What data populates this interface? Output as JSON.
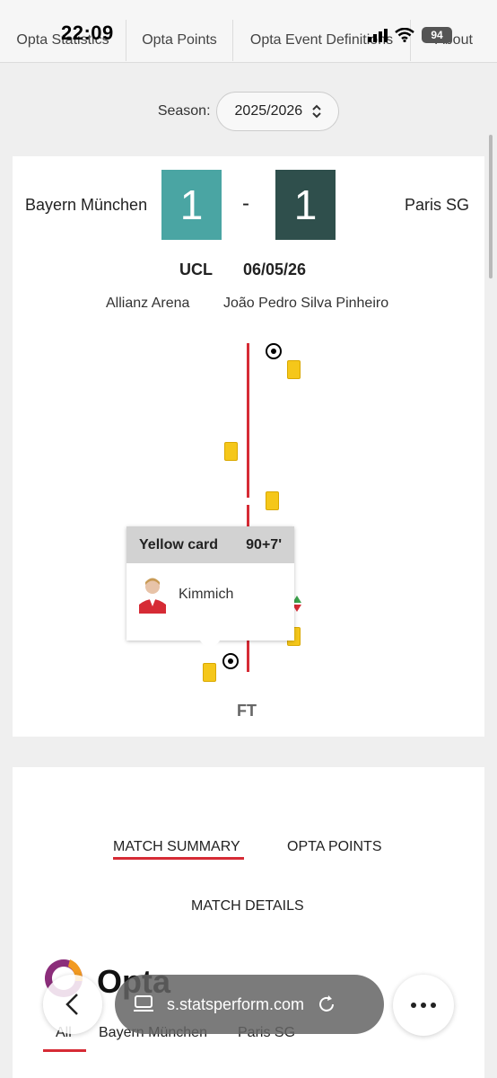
{
  "status_bar": {
    "time": "22:09",
    "battery": "94"
  },
  "nav": {
    "tabs": [
      "Opta Statistics",
      "Opta Points",
      "Opta Event Definitions",
      "About"
    ]
  },
  "season": {
    "label": "Season:",
    "value": "2025/2026"
  },
  "match": {
    "home_team": "Bayern München",
    "away_team": "Paris SG",
    "home_score": "1",
    "away_score": "1",
    "dash": "-",
    "competition": "UCL",
    "date": "06/05/26",
    "venue": "Allianz Arena",
    "referee": "João Pedro Silva Pinheiro",
    "full_time": "FT",
    "colors": {
      "home": "#4aa5a3",
      "away": "#2f4f4c",
      "timeline": "#d62b35",
      "yellow_card": "#f5c71a"
    }
  },
  "tooltip": {
    "event": "Yellow card",
    "minute": "90+7'",
    "player": "Kimmich"
  },
  "summary": {
    "tabs": [
      "MATCH SUMMARY",
      "OPTA POINTS"
    ],
    "details_tab": "MATCH DETAILS",
    "filter_tabs": [
      "All",
      "Bayern München",
      "Paris SG"
    ],
    "brand": "Opta"
  },
  "browser": {
    "url": "s.statsperform.com"
  }
}
